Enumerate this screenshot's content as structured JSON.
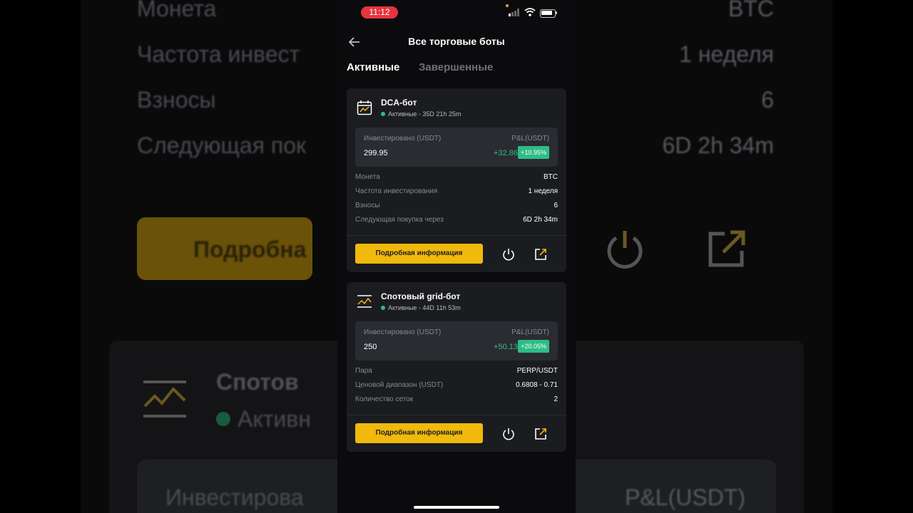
{
  "statusbar": {
    "time": "11:12"
  },
  "header": {
    "title": "Все торговые боты"
  },
  "tabs": [
    {
      "label": "Активные"
    },
    {
      "label": "Завершенные"
    }
  ],
  "bots": [
    {
      "name": "DCA-бот",
      "status": "Активные - 35D 21h 25m",
      "invested_label": "Инвестировано (USDT)",
      "pnl_label": "P&L(USDT)",
      "invested": "299.95",
      "pnl": "+32.86",
      "pnl_pct": "+10.95%",
      "rows": [
        {
          "k": "Монета",
          "v": "BTC"
        },
        {
          "k": "Частота инвестирования",
          "v": "1 неделя"
        },
        {
          "k": "Взносы",
          "v": "6"
        },
        {
          "k": "Следующая покупка через",
          "v": "6D 2h 34m"
        }
      ],
      "button": "Подробная информация"
    },
    {
      "name": "Спотовый grid-бот",
      "status": "Активные - 44D 11h 53m",
      "invested_label": "Инвестировано (USDT)",
      "pnl_label": "P&L(USDT)",
      "invested": "250",
      "pnl": "+50.13",
      "pnl_pct": "+20.05%",
      "rows": [
        {
          "k": "Пара",
          "v": "PERP/USDT"
        },
        {
          "k": "Ценовой диапазон (USDT)",
          "v": "0.6808 - 0.71"
        },
        {
          "k": "Количество сеток",
          "v": "2"
        }
      ],
      "button": "Подробная информация"
    }
  ],
  "background": {
    "left": [
      "Монета",
      "Частота инвест",
      "Взносы",
      "Следующая пок",
      "Подробна",
      "Спотов",
      "Активн",
      "Инвестирова"
    ],
    "right": [
      "BTC",
      "1 неделя",
      "6",
      "6D 2h 34m",
      "P&L(USDT)"
    ]
  },
  "colors": {
    "accent": "#f0b90b",
    "positive": "#2ebd85",
    "card": "#1b1c20"
  }
}
